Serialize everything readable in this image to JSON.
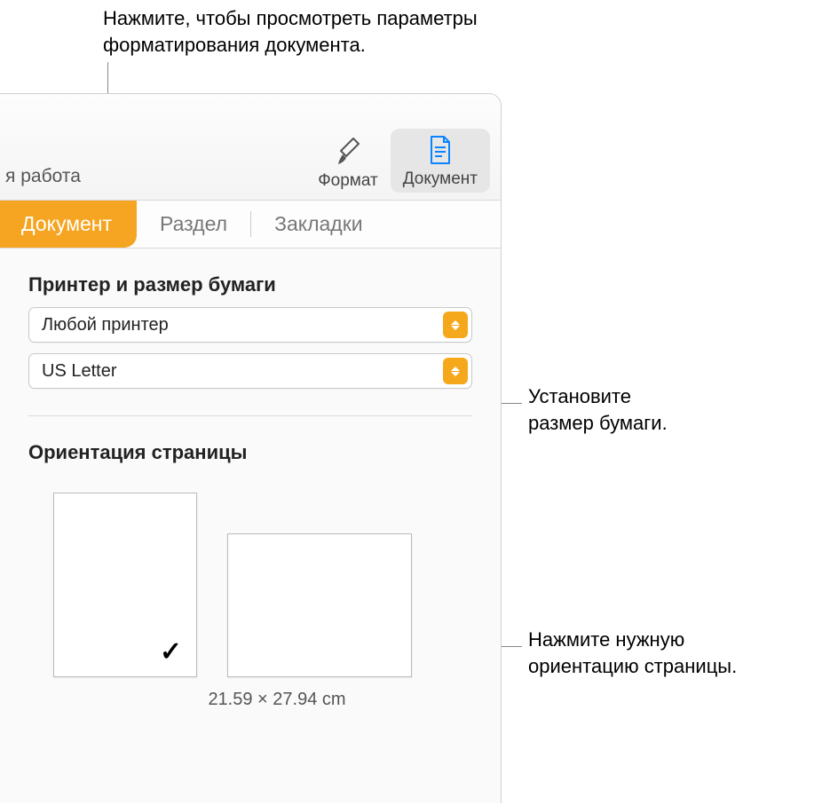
{
  "callouts": {
    "top": "Нажмите, чтобы просмотреть параметры\nформатирования документа.",
    "paper": "Установите\nразмер бумаги.",
    "orient": "Нажмите нужную\nориентацию страницы."
  },
  "toolbar": {
    "left_fragment": "я работа",
    "format": "Формат",
    "document": "Документ"
  },
  "tabs": {
    "document": "Документ",
    "section": "Раздел",
    "bookmarks": "Закладки"
  },
  "printer_section": {
    "title": "Принтер и размер бумаги",
    "printer": "Любой принтер",
    "paper": "US Letter"
  },
  "orientation_section": {
    "title": "Ориентация страницы",
    "dimensions": "21.59 × 27.94 cm"
  }
}
